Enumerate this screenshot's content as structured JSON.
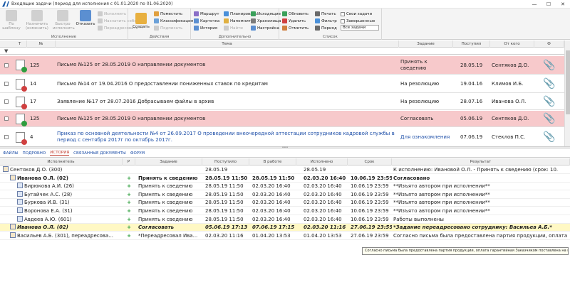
{
  "window": {
    "title": "Входящие задачи (период для исполнения с 01.01.2020 по 01.06.2020)"
  },
  "ribbon": {
    "groups": {
      "execution": "Исполнение",
      "actions": "Действия",
      "additional": "Дополнительно",
      "list": "Список"
    },
    "buttons": {
      "by_template": "По шаблону",
      "change_assign": "Назначить (изменить)",
      "quick_execute": "Быстро исполнить",
      "reject": "Отказать",
      "create": "Создать",
      "execute": "Исполнить",
      "assign_self": "Назначить себя",
      "readdress": "Переадресовать",
      "place": "Поместить",
      "classification": "Классификация",
      "sign": "Подписать",
      "route": "Маршрут",
      "card": "Карточка",
      "history": "История",
      "plan": "Планировать",
      "remind": "Напомнить",
      "find": "Найти",
      "outgoing": "Исходящие",
      "storage": "Хранилища",
      "settings": "Настройка",
      "refresh": "Обновить",
      "delete": "Удалить",
      "mark": "Отметить",
      "print": "Печать",
      "filter": "Фильтр",
      "period": "Период",
      "own_tasks": "Свои задачи",
      "finished": "Завершенные",
      "all_tasks": "Все задачи"
    }
  },
  "grid": {
    "headers": {
      "t": "Т",
      "num": "№",
      "subject": "Тема",
      "task": "Задание",
      "received": "Поступил",
      "from": "От кого",
      "f": "Ф"
    },
    "rows": [
      {
        "num": "125",
        "subject": "Письмо №125 от 28.05.2019 О направлении документов",
        "task": "Принять к сведению",
        "received": "28.05.19",
        "from": "Сентяков Д.О.",
        "pink": true,
        "link": false
      },
      {
        "num": "14",
        "subject": "Письмо №14 от 19.04.2016 О предоставлении пониженных ставок по кредитам",
        "task": "На резолюцию",
        "received": "19.04.16",
        "from": "Климов И.Б.",
        "pink": false,
        "link": false
      },
      {
        "num": "17",
        "subject": "Заявление №17 от 28.07.2016 Добрасываем файлы в архив",
        "task": "На резолюцию",
        "received": "28.07.16",
        "from": "Иванова О.Л.",
        "pink": false,
        "link": false
      },
      {
        "num": "125",
        "subject": "Письмо №125 от 28.05.2019 О направлении документов",
        "task": "Согласовать",
        "received": "05.06.19",
        "from": "Сентяков Д.О.",
        "pink": true,
        "link": false
      },
      {
        "num": "4",
        "subject": "Приказ по основной деятельности №4 от 26.09.2017 О проведении внеочередной аттестации сотрудников кадровой службы в период с сентября 2017г по октябрь 2017г.",
        "task": "Для ознакомления",
        "received": "07.06.19",
        "from": "Стеклов П.С.",
        "pink": false,
        "link": true
      }
    ]
  },
  "tabs": [
    "ФАЙЛЫ",
    "ПОДРОБНО",
    "ИСТОРИЯ",
    "СВЯЗАННЫЕ ДОКУМЕНТЫ",
    "ФОРУМ"
  ],
  "active_tab": "ИСТОРИЯ",
  "history": {
    "headers": {
      "executor": "Исполнитель",
      "r": "Р",
      "task": "Задание",
      "received": "Поступило",
      "in_work": "В работе",
      "executed": "Исполнено",
      "deadline": "Срок",
      "result": "Результат"
    },
    "rows": [
      {
        "executor": "Сентяков Д.О. (300)",
        "r": "",
        "task": "",
        "received": "28.05.19",
        "in_work": "",
        "executed": "28.05.19",
        "deadline": "",
        "result": "К исполнению:  Ивановой О.Л. - Принять к сведению (срок: 10.",
        "style": "",
        "indent": 0
      },
      {
        "executor": "Иванова О.Л. (02)",
        "r": "+",
        "task": "Принять к сведению",
        "received": "28.05.19 11:50",
        "in_work": "28.05.19 11:50",
        "executed": "02.03.20 16:40",
        "deadline": "10.06.19 23:59",
        "result": "Согласовано",
        "style": "b",
        "indent": 1
      },
      {
        "executor": "Бирюкова А.И. (26)",
        "r": "+",
        "task": "Принять к сведению",
        "received": "28.05.19 11:50",
        "in_work": "02.03.20 16:40",
        "executed": "02.03.20 16:40",
        "deadline": "10.06.19 23:59",
        "result": "**Изъято автором при исполнении**",
        "style": "",
        "indent": 2
      },
      {
        "executor": "Бугайчек А.С. (28)",
        "r": "+",
        "task": "Принять к сведению",
        "received": "28.05.19 11:50",
        "in_work": "02.03.20 16:40",
        "executed": "02.03.20 16:40",
        "deadline": "10.06.19 23:59",
        "result": "**Изъято автором при исполнении**",
        "style": "",
        "indent": 2
      },
      {
        "executor": "Буркова И.В. (31)",
        "r": "+",
        "task": "Принять к сведению",
        "received": "28.05.19 11:50",
        "in_work": "02.03.20 16:40",
        "executed": "02.03.20 16:40",
        "deadline": "10.06.19 23:59",
        "result": "**Изъято автором при исполнении**",
        "style": "",
        "indent": 2
      },
      {
        "executor": "Воронова Е.А. (31)",
        "r": "+",
        "task": "Принять к сведению",
        "received": "28.05.19 11:50",
        "in_work": "02.03.20 16:40",
        "executed": "02.03.20 16:40",
        "deadline": "10.06.19 23:59",
        "result": "**Изъято автором при исполнении**",
        "style": "",
        "indent": 2
      },
      {
        "executor": "Авдеев А.Ю. (601)",
        "r": "+",
        "task": "Принять к сведению",
        "received": "28.05.19 11:50",
        "in_work": "02.03.20 16:40",
        "executed": "02.03.20 16:40",
        "deadline": "10.06.19 23:59",
        "result": "Работы выполнены",
        "style": "",
        "indent": 2
      },
      {
        "executor": "Иванова О.Л. (02)",
        "r": "+",
        "task": "Согласовать",
        "received": "05.06.19 17:13",
        "in_work": "07.06.19 17:15",
        "executed": "02.03.20 11:16",
        "deadline": "27.06.19 23:59",
        "result": "*Задание переадресовано сотруднику: Васильев А.Б.*",
        "style": "yel",
        "indent": 1
      },
      {
        "executor": "Васильев А.Б. (301), переадресова...",
        "r": "+",
        "task": "*Переадресовал Ива...",
        "received": "02.03.20 11:16",
        "in_work": "01.04.20 13:53",
        "executed": "01.04.20 13:53",
        "deadline": "27.06.19 23:59",
        "result": "Согласно письма была предоставлена партия продукции, оплата",
        "style": "",
        "indent": 1
      }
    ]
  },
  "tooltip": "Согласно письма была предоставлена партия продукции, оплата гарантийная Заказчиком поставлена на контроль."
}
